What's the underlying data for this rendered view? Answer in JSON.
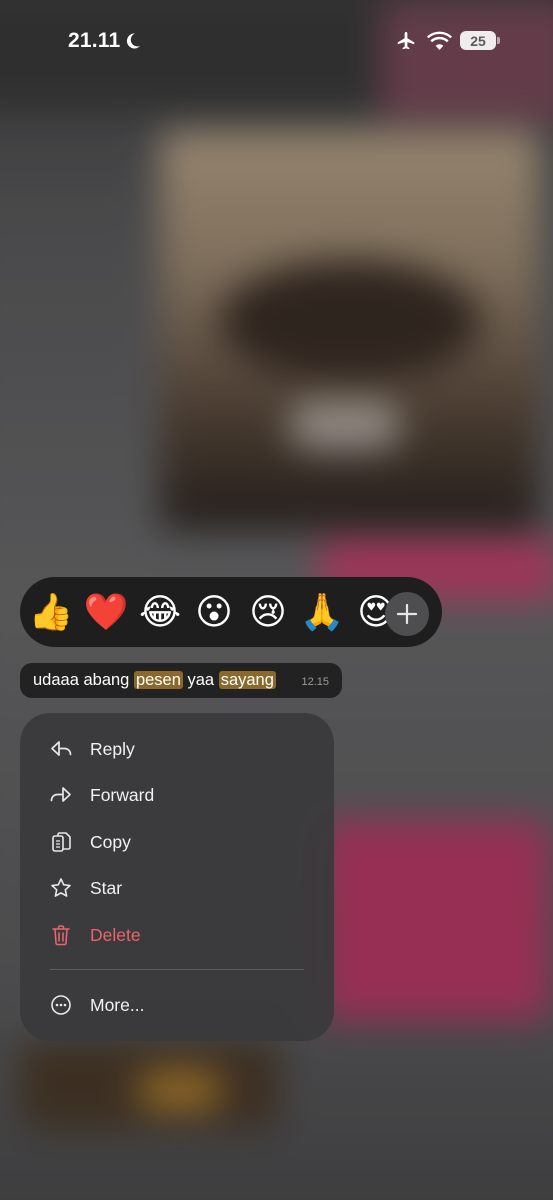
{
  "status_bar": {
    "time": "21.11",
    "battery_level": "25",
    "icons": [
      "moon-icon",
      "airplane-icon",
      "wifi-icon",
      "battery-icon"
    ]
  },
  "reactions": {
    "emojis": [
      "👍",
      "❤️",
      "😂",
      "😮",
      "😢",
      "🙏",
      "😍"
    ],
    "add_icon": "plus-icon"
  },
  "message": {
    "parts": [
      "udaaa abang ",
      "pesen",
      " yaa ",
      "sayang"
    ],
    "time": "12.15",
    "highlight_color": "#8a6a2c"
  },
  "menu": {
    "items": [
      {
        "label": "Reply",
        "icon": "reply-icon"
      },
      {
        "label": "Forward",
        "icon": "forward-icon"
      },
      {
        "label": "Copy",
        "icon": "copy-icon"
      },
      {
        "label": "Star",
        "icon": "star-icon"
      },
      {
        "label": "Delete",
        "icon": "trash-icon",
        "color": "#e8656b"
      }
    ],
    "more": {
      "label": "More...",
      "icon": "more-icon"
    }
  }
}
